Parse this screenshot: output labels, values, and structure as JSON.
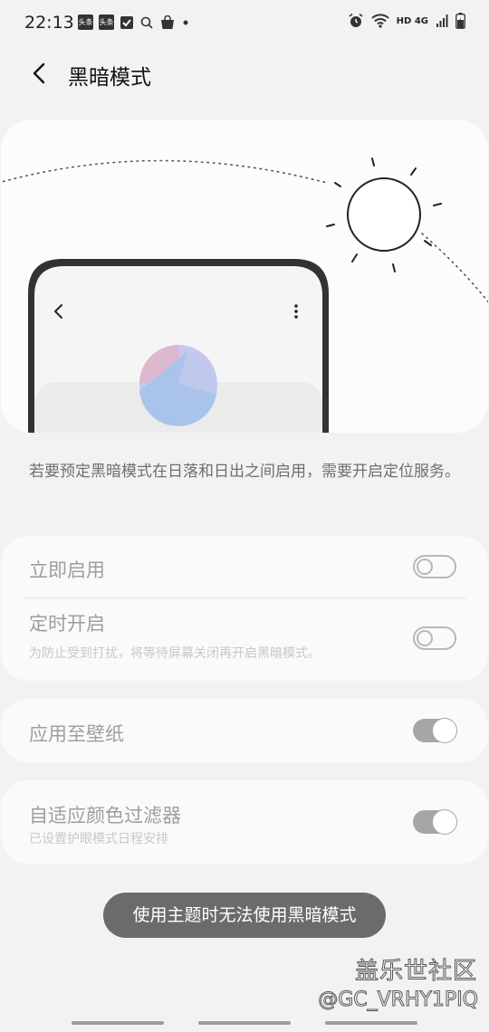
{
  "status_bar": {
    "time": "22:13",
    "notif_badge": "头条",
    "network": "HD 4G",
    "icons": [
      "toutiao-icon",
      "toutiao-icon",
      "check-icon",
      "search-icon",
      "bag-icon",
      "dot-icon",
      "alarm-icon",
      "wifi-icon",
      "signal-icon",
      "battery-icon"
    ]
  },
  "header": {
    "title": "黑暗模式",
    "back_icon": "back-arrow-icon"
  },
  "hero": {
    "illustration": "phone-and-sun-illustration"
  },
  "description": "若要预定黑暗模式在日落和日出之间启用，需要开启定位服务。",
  "settings": {
    "group1": [
      {
        "title": "立即启用",
        "subtitle": "",
        "enabled": false
      },
      {
        "title": "定时开启",
        "subtitle": "为防止受到打扰，将等待屏幕关闭再开启黑暗模式。",
        "enabled": false
      }
    ],
    "wallpaper": {
      "title": "应用至壁纸",
      "enabled": true
    },
    "adaptive": {
      "title": "自适应颜色过滤器",
      "subtitle": "已设置护眼模式日程安排",
      "enabled": true
    }
  },
  "toast": "使用主题时无法使用黑暗模式",
  "watermark": {
    "line1": "盖乐世社区",
    "line2": "@GC_VRHY1PIQ"
  },
  "colors": {
    "background": "#f2f2f2",
    "card": "#fafafa",
    "toggle_on": "#a6a6a6",
    "toast_bg": "#6b6b6b"
  }
}
